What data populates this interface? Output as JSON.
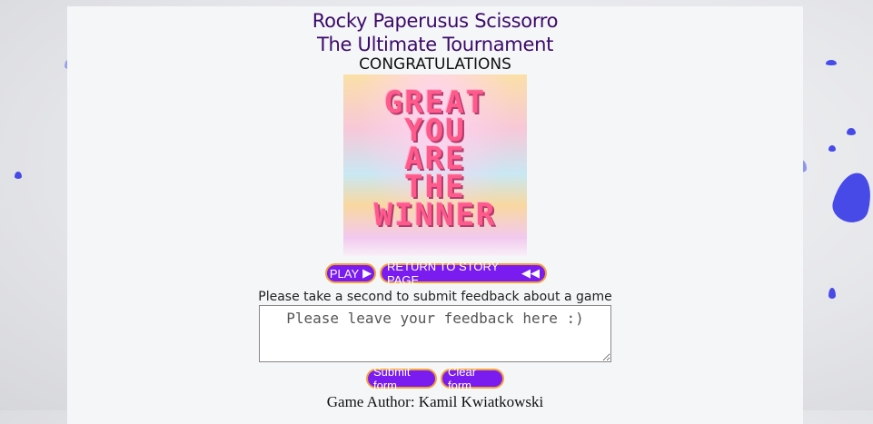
{
  "header": {
    "title_line1": "Rocky Paperusus Scissorro",
    "title_line2": "The Ultimate Tournament",
    "congrats": "CONGRATULATIONS"
  },
  "winner_image": {
    "text": [
      "GREAT",
      "YOU",
      "ARE",
      "THE",
      "WINNER"
    ]
  },
  "buttons": {
    "play": "PLAY",
    "return": "RETURN TO STORY PAGE",
    "submit": "Submit form",
    "clear": "Clear form"
  },
  "feedback": {
    "label": "Please take a second to submit feedback about a game",
    "placeholder": "Please leave your feedback here :)"
  },
  "footer": {
    "author": "Game Author: Kamil Kwiatkowski"
  },
  "colors": {
    "accent": "#7a1bf0",
    "button_border": "#f2a23a",
    "title": "#3c0a6a",
    "petal": "#8f93f0"
  }
}
